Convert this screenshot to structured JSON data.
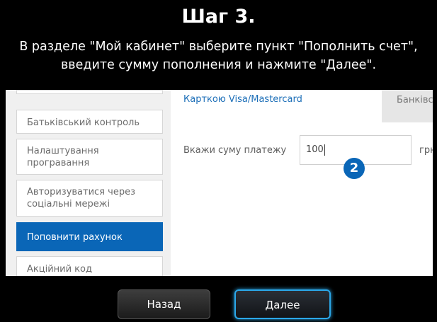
{
  "header": {
    "title": "Шаг 3.",
    "instruction_line1": "В разделе \"Мой кабинет\" выберите пункт \"Пополнить счет\",",
    "instruction_line2": "введите сумму пополнения и нажмите \"Далее\"."
  },
  "sidebar": {
    "items": [
      {
        "label_line1": "Батьківський контроль",
        "label_line2": ""
      },
      {
        "label_line1": "Налаштування",
        "label_line2": "програвання"
      },
      {
        "label_line1": "Авторизуватися через",
        "label_line2": "соціальні мережі"
      },
      {
        "label_line1": "Поповнити рахунок",
        "label_line2": ""
      },
      {
        "label_line1": "Акційний код",
        "label_line2": ""
      }
    ],
    "active_index": 3
  },
  "payment": {
    "tab_card": "Карткою Visa/Mastercard",
    "tab_bank": "Банківс",
    "amount_label": "Вкажи суму платежу",
    "amount_value": "100",
    "currency": "грн"
  },
  "step_badge": "2",
  "buttons": {
    "back": "Назад",
    "next": "Далее"
  },
  "colors": {
    "accent_blue": "#0a66b7",
    "next_button_border": "#2ba7e8",
    "background": "#000000"
  }
}
